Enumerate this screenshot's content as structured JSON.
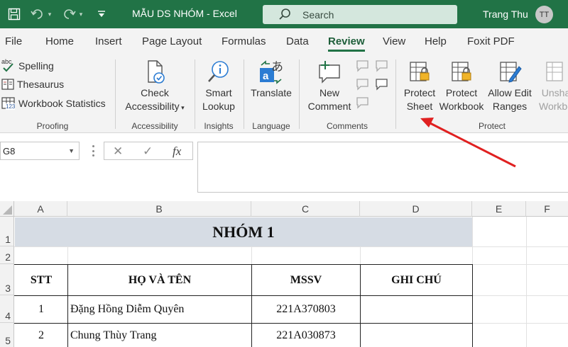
{
  "window": {
    "file_title": "MẪU DS NHÓM",
    "app_name": "Excel",
    "search_placeholder": "Search",
    "user_name": "Trang Thu",
    "user_initials": "TT",
    "accent_color": "#217346"
  },
  "tabs": [
    "File",
    "Home",
    "Insert",
    "Page Layout",
    "Formulas",
    "Data",
    "Review",
    "View",
    "Help",
    "Foxit PDF"
  ],
  "active_tab": "Review",
  "ribbon": {
    "proofing": {
      "spelling": "Spelling",
      "spelling_badge": "abc",
      "thesaurus": "Thesaurus",
      "workbook_statistics": "Workbook Statistics",
      "stats_badge": "123",
      "group": "Proofing"
    },
    "accessibility": {
      "check_line1": "Check",
      "check_line2": "Accessibility",
      "group": "Accessibility"
    },
    "insights": {
      "smart_line1": "Smart",
      "smart_line2": "Lookup",
      "group": "Insights"
    },
    "language": {
      "translate": "Translate",
      "group": "Language"
    },
    "comments": {
      "new_line1": "New",
      "new_line2": "Comment",
      "group": "Comments"
    },
    "protect": {
      "sheet_line1": "Protect",
      "sheet_line2": "Sheet",
      "workbook_line1": "Protect",
      "workbook_line2": "Workbook",
      "allow_line1": "Allow Edit",
      "allow_line2": "Ranges",
      "unshare_line1": "Unsha",
      "unshare_line2": "Workbo",
      "group": "Protect"
    }
  },
  "formula_bar": {
    "name_box": "G8",
    "cancel_symbol": "✕",
    "enter_symbol": "✓",
    "fx_label": "fx",
    "formula": ""
  },
  "sheet": {
    "columns": [
      "A",
      "B",
      "C",
      "D",
      "E",
      "F"
    ],
    "rows": [
      "1",
      "2",
      "3",
      "4",
      "5"
    ],
    "title": "NHÓM 1",
    "headers": [
      "STT",
      "HỌ VÀ TÊN",
      "MSSV",
      "GHI CHÚ"
    ],
    "records": [
      {
        "stt": "1",
        "name": "Đặng Hồng Diễm Quyên",
        "mssv": "221A370803",
        "note": ""
      },
      {
        "stt": "2",
        "name": "Chung Thùy Trang",
        "mssv": "221A030873",
        "note": ""
      }
    ]
  },
  "annotation": {
    "arrow_color": "#e02020",
    "points_to": "Protect Sheet"
  }
}
